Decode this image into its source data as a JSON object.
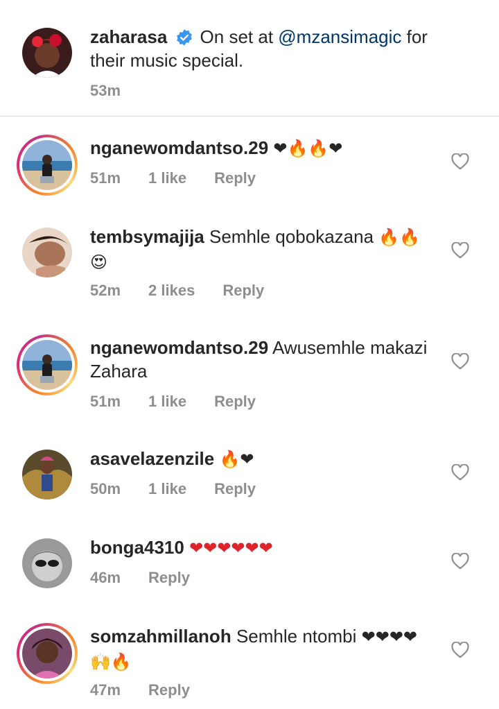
{
  "caption": {
    "username": "zaharasa",
    "verified_icon": "verified-badge-icon",
    "text_before": "On set at ",
    "mention": "@mzansimagic",
    "text_after": " for their music special.",
    "time": "53m"
  },
  "comments": [
    {
      "username": "nganewomdantso.29",
      "text": "",
      "emoji": "❤🔥🔥❤",
      "time": "51m",
      "likes": "1 like",
      "reply": "Reply",
      "has_story_ring": true
    },
    {
      "username": "tembsymajija",
      "text": "Semhle qobokazana",
      "emoji": "🔥🔥😍",
      "time": "52m",
      "likes": "2 likes",
      "reply": "Reply",
      "has_story_ring": false
    },
    {
      "username": "nganewomdantso.29",
      "text": "Awusemhle makazi Zahara",
      "emoji": "",
      "time": "51m",
      "likes": "1 like",
      "reply": "Reply",
      "has_story_ring": true
    },
    {
      "username": "asavelazenzile",
      "text": "",
      "emoji": "🔥❤",
      "time": "50m",
      "likes": "1 like",
      "reply": "Reply",
      "has_story_ring": false
    },
    {
      "username": "bonga4310",
      "text": "",
      "emoji": "❤❤❤❤❤❤",
      "time": "46m",
      "likes": "",
      "reply": "Reply",
      "has_story_ring": false
    },
    {
      "username": "somzahmillanoh",
      "text": "Semhle ntombi",
      "emoji": "❤❤❤❤🙌🔥",
      "time": "47m",
      "likes": "",
      "reply": "Reply",
      "has_story_ring": true
    }
  ],
  "icons": {
    "like": "heart-outline-icon"
  },
  "colors": {
    "mention": "#00376b",
    "meta": "#8e8e8e",
    "verified": "#3897f0"
  }
}
